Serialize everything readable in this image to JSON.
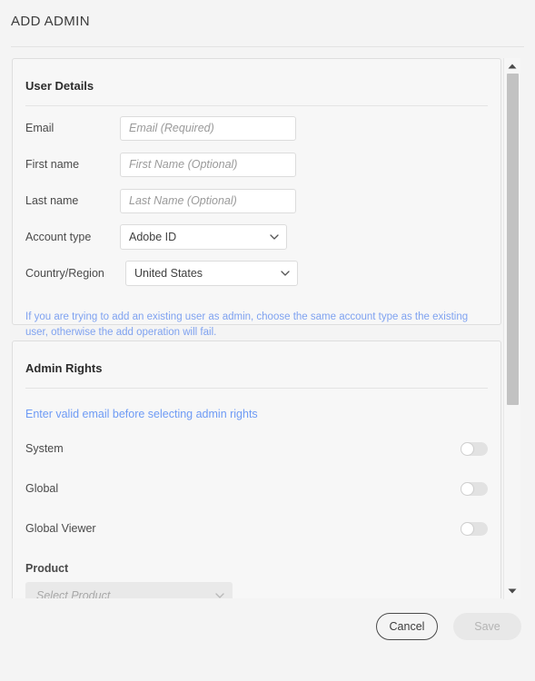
{
  "header": {
    "title": "ADD ADMIN"
  },
  "user_details": {
    "section_title": "User Details",
    "fields": [
      {
        "label": "Email",
        "placeholder": "Email (Required)",
        "value": "",
        "type": "text"
      },
      {
        "label": "First name",
        "placeholder": "First Name (Optional)",
        "value": "",
        "type": "text"
      },
      {
        "label": "Last name",
        "placeholder": "Last Name (Optional)",
        "value": "",
        "type": "text"
      }
    ],
    "account_type": {
      "label": "Account type",
      "selected": "Adobe ID",
      "icon": "chevron-down-icon"
    },
    "country_region": {
      "label": "Country/Region",
      "selected": "United States",
      "icon": "chevron-down-icon"
    },
    "helper_note": "If you are trying to add an existing user as admin, choose the same account type as the existing user, otherwise the add operation will fail."
  },
  "admin_rights": {
    "section_title": "Admin Rights",
    "note": "Enter valid email before selecting admin rights",
    "toggles": [
      {
        "label": "System",
        "state": "off"
      },
      {
        "label": "Global",
        "state": "off"
      },
      {
        "label": "Global Viewer",
        "state": "off"
      }
    ],
    "product": {
      "label": "Product",
      "placeholder": "Select Product",
      "disabled": true,
      "icon": "chevron-down-icon"
    }
  },
  "scrollbar": {
    "up_icon": "scroll-up-arrow-icon",
    "down_icon": "scroll-down-arrow-icon"
  },
  "footer": {
    "cancel_label": "Cancel",
    "save_label": "Save",
    "save_disabled": true
  },
  "colors": {
    "background": "#f4f4f4",
    "card_background": "#f7f7f7",
    "card_border": "#dedede",
    "text_primary": "#3c3c3c",
    "text_secondary": "#4a4a4a",
    "placeholder": "#9a9a9a",
    "link_blue": "#6e9bf5",
    "helper_blue": "#7fa2f0",
    "toggle_off_track": "#e2e2e2",
    "scroll_thumb": "#c2c2c2",
    "save_disabled_bg": "#e8e8e8",
    "save_disabled_text": "#b4b4b4"
  }
}
